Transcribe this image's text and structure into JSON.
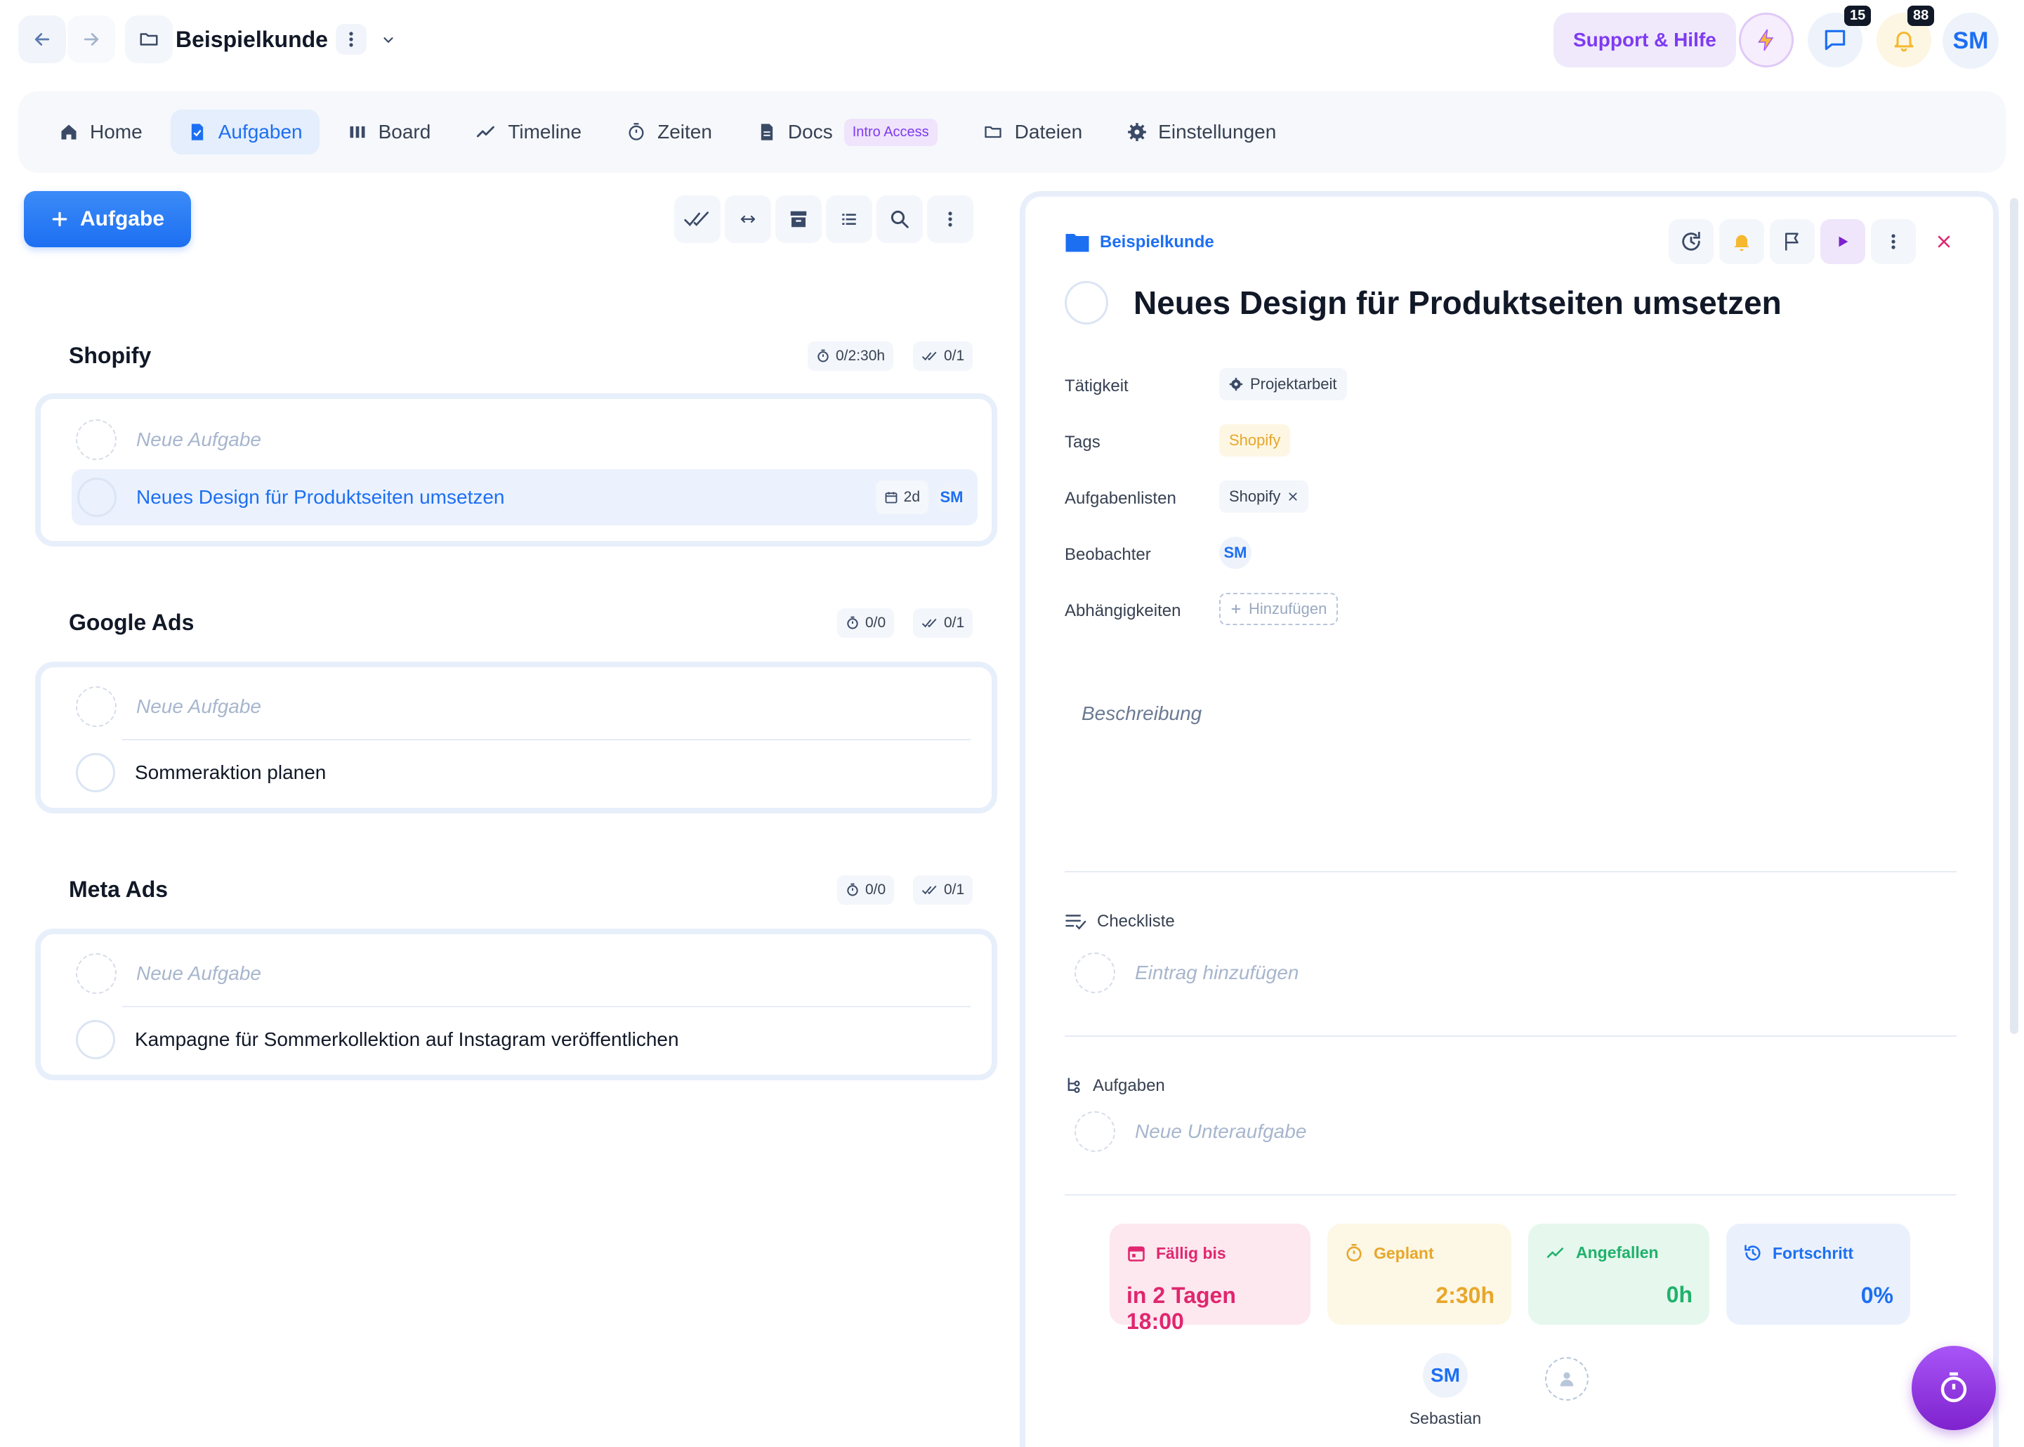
{
  "project": {
    "name": "Beispielkunde"
  },
  "header": {
    "support_label": "Support & Hilfe",
    "messages_count": "15",
    "notifications_count": "88",
    "user_initials": "SM"
  },
  "tabs": [
    {
      "label": "Home",
      "icon": "home-icon"
    },
    {
      "label": "Aufgaben",
      "icon": "task-doc-icon",
      "active": true
    },
    {
      "label": "Board",
      "icon": "board-icon"
    },
    {
      "label": "Timeline",
      "icon": "trend-icon"
    },
    {
      "label": "Zeiten",
      "icon": "stopwatch-icon"
    },
    {
      "label": "Docs",
      "icon": "doc-icon",
      "badge": "Intro Access"
    },
    {
      "label": "Dateien",
      "icon": "folder-icon"
    },
    {
      "label": "Einstellungen",
      "icon": "gear-icon"
    }
  ],
  "left": {
    "add_task_label": "Aufgabe",
    "new_task_placeholder": "Neue Aufgabe",
    "groups": [
      {
        "title": "Shopify",
        "time": "0/2:30h",
        "done": "0/1",
        "tasks": [
          {
            "title": "Neues Design für Produktseiten umsetzen",
            "due": "2d",
            "assignee": "SM",
            "selected": true
          }
        ]
      },
      {
        "title": "Google Ads",
        "time": "0/0",
        "done": "0/1",
        "tasks": [
          {
            "title": "Sommeraktion planen"
          }
        ]
      },
      {
        "title": "Meta Ads",
        "time": "0/0",
        "done": "0/1",
        "tasks": [
          {
            "title": "Kampagne für Sommerkollektion auf Instagram veröffentlichen"
          }
        ]
      }
    ]
  },
  "detail": {
    "breadcrumb": "Beispielkunde",
    "title": "Neues Design für Produktseiten umsetzen",
    "properties": {
      "activity_label": "Tätigkeit",
      "activity_value": "Projektarbeit",
      "tags_label": "Tags",
      "tag_value": "Shopify",
      "lists_label": "Aufgabenlisten",
      "list_value": "Shopify",
      "watchers_label": "Beobachter",
      "watcher": "SM",
      "deps_label": "Abhängigkeiten",
      "deps_add": "Hinzufügen"
    },
    "description_placeholder": "Beschreibung",
    "checklist": {
      "label": "Checkliste",
      "placeholder": "Eintrag hinzufügen"
    },
    "subtasks": {
      "label": "Aufgaben",
      "placeholder": "Neue Unteraufgabe"
    },
    "stats": {
      "due": {
        "label": "Fällig bis",
        "value": "in 2 Tagen 18:00"
      },
      "planned": {
        "label": "Geplant",
        "value": "2:30h"
      },
      "spent": {
        "label": "Angefallen",
        "value": "0h"
      },
      "progress": {
        "label": "Fortschritt",
        "value": "0%"
      }
    },
    "assignee": {
      "initials": "SM",
      "name": "Sebastian"
    }
  },
  "colors": {
    "primary": "#1d6ff2",
    "purple": "#7e3af2",
    "due": "#e0266f",
    "planned": "#e8a72a",
    "spent": "#20b26b",
    "progress": "#1d6ff2"
  }
}
